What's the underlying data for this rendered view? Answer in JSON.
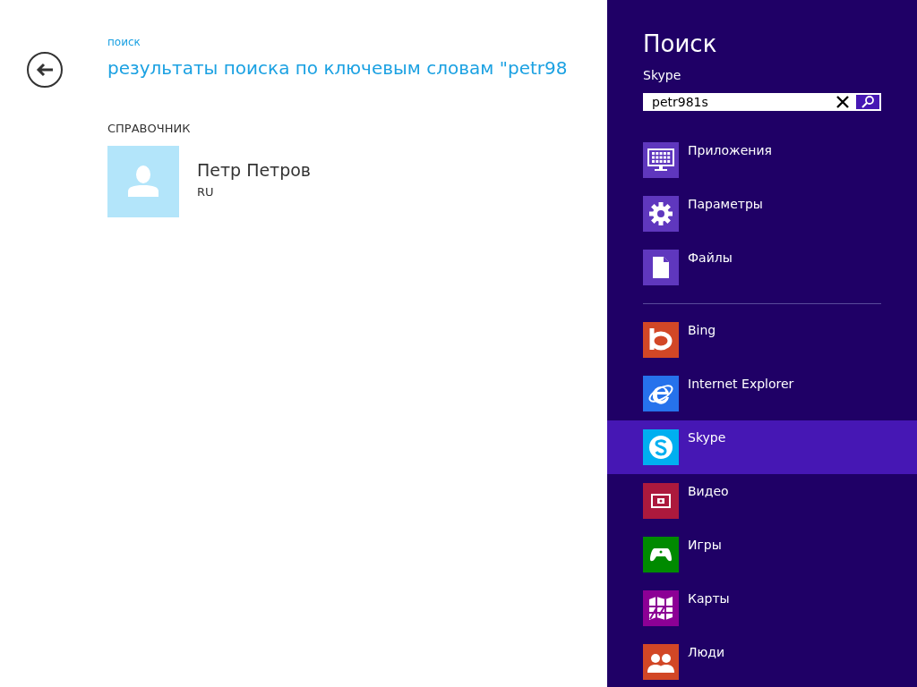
{
  "page": {
    "breadcrumb": "поиск",
    "title": "результаты поиска по ключевым словам \"petr98",
    "section": "СПРАВОЧНИК",
    "results": [
      {
        "name": "Петр Петров",
        "subtitle": "RU"
      }
    ]
  },
  "search_pane": {
    "title": "Поиск",
    "scope": "Skype",
    "search": {
      "value": "petr981s"
    },
    "scopes": [
      {
        "label": "Приложения",
        "selected": false
      },
      {
        "label": "Параметры",
        "selected": false
      },
      {
        "label": "Файлы",
        "selected": false
      }
    ],
    "apps": [
      {
        "label": "Bing",
        "color": "#d24726",
        "selected": false
      },
      {
        "label": "Internet Explorer",
        "color": "#2672ec",
        "selected": false
      },
      {
        "label": "Skype",
        "color": "#00aff0",
        "selected": true
      },
      {
        "label": "Видео",
        "color": "#ac193d",
        "selected": false
      },
      {
        "label": "Игры",
        "color": "#008a00",
        "selected": false
      },
      {
        "label": "Карты",
        "color": "#8c0095",
        "selected": false
      },
      {
        "label": "Люди",
        "color": "#d24726",
        "selected": false
      }
    ]
  }
}
